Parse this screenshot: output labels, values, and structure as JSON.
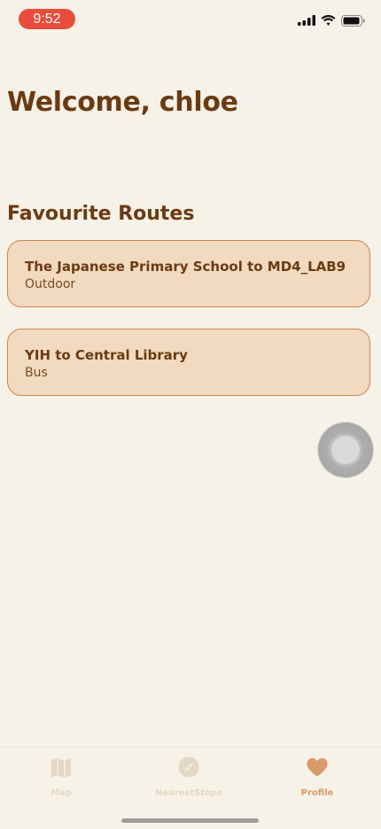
{
  "status_bar": {
    "time": "9:52",
    "time_pill_color": "#E74C3C",
    "icons": [
      "cellular-signal-icon",
      "wifi-icon",
      "battery-icon"
    ]
  },
  "welcome": {
    "greeting": "Welcome, ",
    "username": "chloe"
  },
  "favourites": {
    "title": "Favourite Routes",
    "routes": [
      {
        "name": "The Japanese Primary School to MD4_LAB9",
        "mode": "Outdoor"
      },
      {
        "name": "YIH to Central Library",
        "mode": "Bus"
      }
    ]
  },
  "tab_bar": {
    "tabs": [
      {
        "label": "Map",
        "icon": "map-icon",
        "active": false
      },
      {
        "label": "NearestStops",
        "icon": "compass-icon",
        "active": false
      },
      {
        "label": "Profile",
        "icon": "heart-icon",
        "active": true
      }
    ]
  },
  "colors": {
    "background": "#F7F2E7",
    "primary_text": "#6B3A13",
    "card_fill": "#F1DAC0",
    "card_border": "#CF8453",
    "tab_active": "#D99A6C",
    "tab_inactive": "#E4D8C5"
  }
}
